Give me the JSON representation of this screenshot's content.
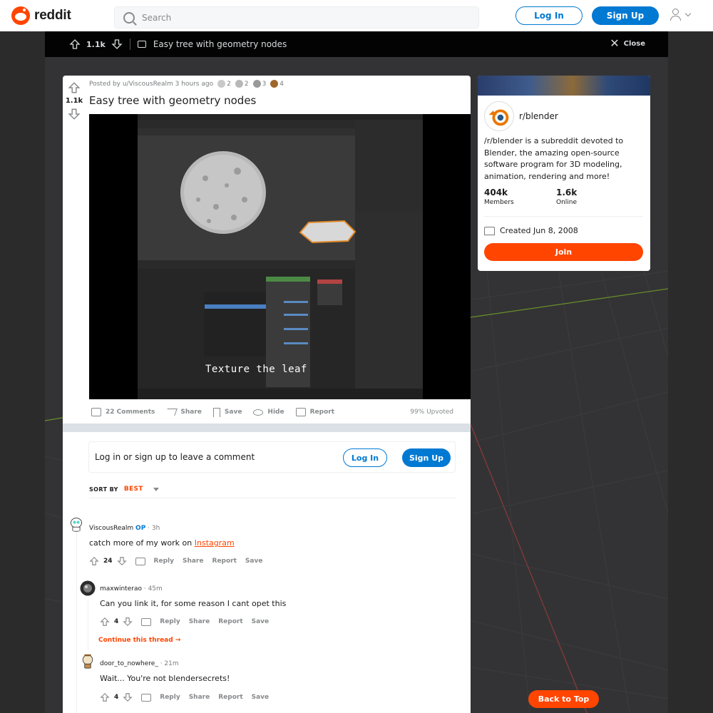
{
  "header": {
    "logo_text": "reddit",
    "search_placeholder": "Search",
    "login_label": "Log In",
    "signup_label": "Sign Up"
  },
  "post_bar": {
    "votes": "1.1k",
    "title": "Easy tree with geometry nodes",
    "close_label": "Close"
  },
  "post": {
    "votes": "1.1k",
    "posted_by": "Posted by u/ViscousRealm 3 hours ago",
    "awards": [
      "2",
      "2",
      "3",
      "4"
    ],
    "title": "Easy tree with geometry nodes",
    "video_caption": "Texture the leaf",
    "actions": {
      "comments": "22 Comments",
      "share": "Share",
      "save": "Save",
      "hide": "Hide",
      "report": "Report"
    },
    "upvoted": "99% Upvoted"
  },
  "comment_box": {
    "prompt": "Log in or sign up to leave a comment",
    "login_label": "Log In",
    "signup_label": "Sign Up"
  },
  "sort": {
    "label": "SORT BY",
    "value": "BEST"
  },
  "comments": [
    {
      "author": "ViscousRealm",
      "op": "OP",
      "time": "· 3h",
      "body_prefix": "catch more of my work on ",
      "body_link": "Instagram",
      "score": "24",
      "reply": "Reply",
      "share": "Share",
      "report": "Report",
      "save": "Save"
    },
    {
      "author": "maxwinterao",
      "time": "· 45m",
      "body": "Can you link it, for some reason I cant opet this",
      "score": "4",
      "reply": "Reply",
      "share": "Share",
      "report": "Report",
      "save": "Save",
      "continue": "Continue this thread →"
    },
    {
      "author": "door_to_nowhere_",
      "time": "· 21m",
      "body": "Wait... You're not blendersecrets!",
      "score": "4",
      "reply": "Reply",
      "share": "Share",
      "report": "Report",
      "save": "Save"
    }
  ],
  "sidebar": {
    "name": "r/blender",
    "description": "/r/blender is a subreddit devoted to Blender, the amazing open-source software program for 3D modeling, animation, rendering and more!",
    "members_count": "404k",
    "members_label": "Members",
    "online_count": "1.6k",
    "online_label": "Online",
    "created": "Created Jun 8, 2008",
    "join_label": "Join"
  },
  "back_to_top": "Back to Top",
  "colors": {
    "brand": "#ff4500",
    "accent": "#0079d3"
  }
}
